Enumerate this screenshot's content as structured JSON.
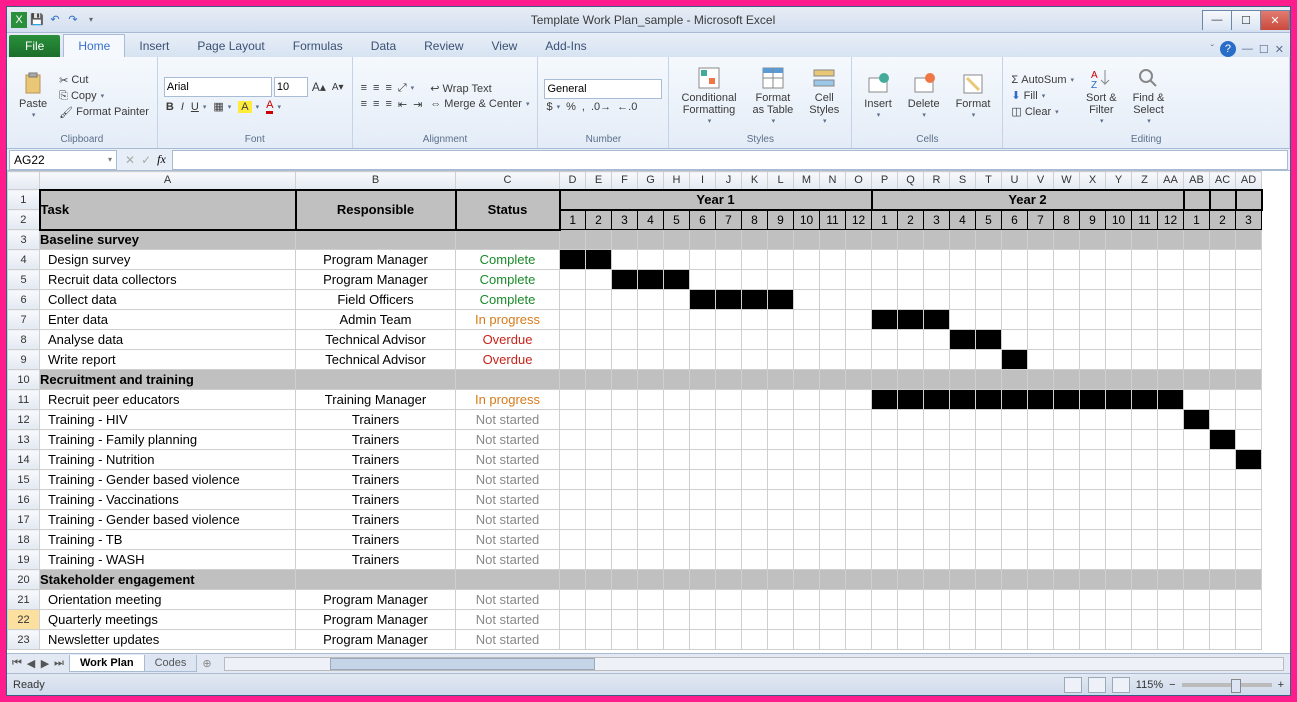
{
  "window": {
    "title": "Template Work Plan_sample  -  Microsoft Excel"
  },
  "tabs": {
    "file": "File",
    "home": "Home",
    "insert": "Insert",
    "page_layout": "Page Layout",
    "formulas": "Formulas",
    "data": "Data",
    "review": "Review",
    "view": "View",
    "addins": "Add-Ins"
  },
  "ribbon": {
    "clipboard": {
      "paste": "Paste",
      "cut": "Cut",
      "copy": "Copy",
      "format_painter": "Format Painter",
      "label": "Clipboard"
    },
    "font": {
      "name": "Arial",
      "size": "10",
      "label": "Font"
    },
    "alignment": {
      "wrap": "Wrap Text",
      "merge": "Merge & Center",
      "label": "Alignment"
    },
    "number": {
      "format": "General",
      "label": "Number"
    },
    "styles": {
      "cond": "Conditional\nFormatting",
      "fat": "Format\nas Table",
      "cell": "Cell\nStyles",
      "label": "Styles"
    },
    "cells": {
      "insert": "Insert",
      "delete": "Delete",
      "format": "Format",
      "label": "Cells"
    },
    "editing": {
      "autosum": "AutoSum",
      "fill": "Fill",
      "clear": "Clear",
      "sort": "Sort &\nFilter",
      "find": "Find &\nSelect",
      "label": "Editing"
    }
  },
  "namebox": "AG22",
  "headers": {
    "task": "Task",
    "responsible": "Responsible",
    "status": "Status",
    "year1": "Year 1",
    "year2": "Year 2",
    "cols": [
      "D",
      "E",
      "F",
      "G",
      "H",
      "I",
      "J",
      "K",
      "L",
      "M",
      "N",
      "O",
      "P",
      "Q",
      "R",
      "S",
      "T",
      "U",
      "V",
      "W",
      "X",
      "Y",
      "Z",
      "AA",
      "AB",
      "AC",
      "AD"
    ],
    "months1": [
      "1",
      "2",
      "3",
      "4",
      "5",
      "6",
      "7",
      "8",
      "9",
      "10",
      "11",
      "12"
    ],
    "months2": [
      "1",
      "2",
      "3",
      "4",
      "5",
      "6",
      "7",
      "8",
      "9",
      "10",
      "11",
      "12"
    ],
    "months3": [
      "1",
      "2",
      "3"
    ]
  },
  "rows": [
    {
      "n": 3,
      "type": "section",
      "task": "Baseline survey"
    },
    {
      "n": 4,
      "task": "Design survey",
      "responsible": "Program Manager",
      "status": "Complete",
      "stclass": "complete",
      "gantt": [
        0,
        1
      ]
    },
    {
      "n": 5,
      "task": "Recruit data collectors",
      "responsible": "Program Manager",
      "status": "Complete",
      "stclass": "complete",
      "gantt": [
        2,
        3,
        4
      ]
    },
    {
      "n": 6,
      "task": "Collect data",
      "responsible": "Field Officers",
      "status": "Complete",
      "stclass": "complete",
      "gantt": [
        5,
        6,
        7,
        8
      ]
    },
    {
      "n": 7,
      "task": "Enter data",
      "responsible": "Admin Team",
      "status": "In progress",
      "stclass": "progress",
      "gantt": [
        12,
        13,
        14
      ]
    },
    {
      "n": 8,
      "task": "Analyse data",
      "responsible": "Technical Advisor",
      "status": "Overdue",
      "stclass": "overdue",
      "gantt": [
        15,
        16
      ]
    },
    {
      "n": 9,
      "task": "Write report",
      "responsible": "Technical Advisor",
      "status": "Overdue",
      "stclass": "overdue",
      "gantt": [
        17
      ]
    },
    {
      "n": 10,
      "type": "section",
      "task": "Recruitment and training"
    },
    {
      "n": 11,
      "task": "Recruit peer educators",
      "responsible": "Training Manager",
      "status": "In progress",
      "stclass": "progress",
      "gantt": [
        12,
        13,
        14,
        15,
        16,
        17,
        18,
        19,
        20,
        21,
        22,
        23
      ]
    },
    {
      "n": 12,
      "task": "Training - HIV",
      "responsible": "Trainers",
      "status": "Not started",
      "stclass": "notstarted",
      "gantt": [
        24
      ]
    },
    {
      "n": 13,
      "task": "Training - Family planning",
      "responsible": "Trainers",
      "status": "Not started",
      "stclass": "notstarted",
      "gantt": [
        25
      ]
    },
    {
      "n": 14,
      "task": "Training - Nutrition",
      "responsible": "Trainers",
      "status": "Not started",
      "stclass": "notstarted",
      "gantt": [
        26
      ]
    },
    {
      "n": 15,
      "task": "Training - Gender based violence",
      "responsible": "Trainers",
      "status": "Not started",
      "stclass": "notstarted",
      "gantt": []
    },
    {
      "n": 16,
      "task": "Training - Vaccinations",
      "responsible": "Trainers",
      "status": "Not started",
      "stclass": "notstarted",
      "gantt": []
    },
    {
      "n": 17,
      "task": "Training - Gender based violence",
      "responsible": "Trainers",
      "status": "Not started",
      "stclass": "notstarted",
      "gantt": []
    },
    {
      "n": 18,
      "task": "Training - TB",
      "responsible": "Trainers",
      "status": "Not started",
      "stclass": "notstarted",
      "gantt": []
    },
    {
      "n": 19,
      "task": "Training - WASH",
      "responsible": "Trainers",
      "status": "Not started",
      "stclass": "notstarted",
      "gantt": []
    },
    {
      "n": 20,
      "type": "section",
      "task": "Stakeholder engagement"
    },
    {
      "n": 21,
      "task": "Orientation meeting",
      "responsible": "Program Manager",
      "status": "Not started",
      "stclass": "notstarted",
      "gantt": []
    },
    {
      "n": 22,
      "task": "Quarterly meetings",
      "responsible": "Program Manager",
      "status": "Not started",
      "stclass": "notstarted",
      "gantt": [],
      "sel": true
    },
    {
      "n": 23,
      "task": "Newsletter updates",
      "responsible": "Program Manager",
      "status": "Not started",
      "stclass": "notstarted",
      "gantt": []
    }
  ],
  "sheets": {
    "active": "Work Plan",
    "other": "Codes"
  },
  "statusbar": {
    "ready": "Ready",
    "zoom": "115%"
  }
}
